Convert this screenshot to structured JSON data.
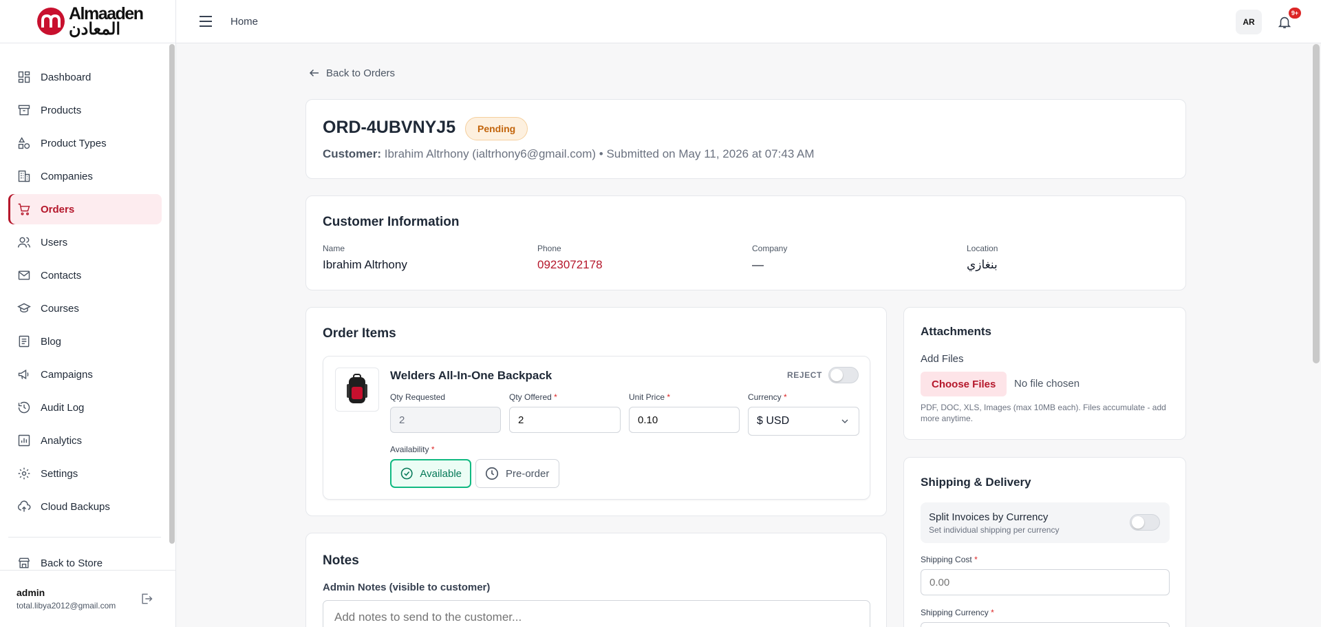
{
  "brand": {
    "name_en": "Almaaden",
    "name_ar": "المعادن"
  },
  "sidebar": {
    "items": [
      {
        "label": "Dashboard",
        "icon": "dashboard-icon"
      },
      {
        "label": "Products",
        "icon": "archive-box-icon"
      },
      {
        "label": "Product Types",
        "icon": "shapes-icon"
      },
      {
        "label": "Companies",
        "icon": "building-icon"
      },
      {
        "label": "Orders",
        "icon": "cart-icon",
        "active": true
      },
      {
        "label": "Users",
        "icon": "users-icon"
      },
      {
        "label": "Contacts",
        "icon": "mail-icon"
      },
      {
        "label": "Courses",
        "icon": "graduation-cap-icon"
      },
      {
        "label": "Blog",
        "icon": "document-icon"
      },
      {
        "label": "Campaigns",
        "icon": "megaphone-icon"
      },
      {
        "label": "Audit Log",
        "icon": "history-icon"
      },
      {
        "label": "Analytics",
        "icon": "chart-icon"
      },
      {
        "label": "Settings",
        "icon": "gear-icon"
      },
      {
        "label": "Cloud Backups",
        "icon": "cloud-backup-icon"
      }
    ],
    "back_to_store": "Back to Store",
    "user": {
      "name": "admin",
      "email": "total.libya2012@gmail.com"
    }
  },
  "topbar": {
    "breadcrumb": "Home",
    "lang": "AR",
    "notifications_badge": "9+"
  },
  "back_link": "Back to Orders",
  "order": {
    "id": "ORD-4UBVNYJ5",
    "status": "Pending",
    "customer_label": "Customer:",
    "customer_text": "Ibrahim Altrhony (ialtrhony6@gmail.com) • Submitted on May 11, 2026 at 07:43 AM"
  },
  "customer_info": {
    "title": "Customer Information",
    "name_label": "Name",
    "name": "Ibrahim Altrhony",
    "phone_label": "Phone",
    "phone": "0923072178",
    "company_label": "Company",
    "company": "—",
    "location_label": "Location",
    "location": "بنغازي"
  },
  "order_items": {
    "title": "Order Items",
    "item": {
      "name": "Welders All-In-One Backpack",
      "reject_label": "REJECT",
      "qty_requested_label": "Qty Requested",
      "qty_requested": "2",
      "qty_offered_label": "Qty Offered",
      "qty_offered": "2",
      "unit_price_label": "Unit Price",
      "unit_price": "0.10",
      "currency_label": "Currency",
      "currency": "$ USD",
      "availability_label": "Availability",
      "available_label": "Available",
      "preorder_label": "Pre-order",
      "selected_availability": "Available"
    }
  },
  "notes": {
    "title": "Notes",
    "admin_label": "Admin Notes (visible to customer)",
    "placeholder": "Add notes to send to the customer..."
  },
  "attachments": {
    "title": "Attachments",
    "add_files": "Add Files",
    "choose_button": "Choose Files",
    "no_file": "No file chosen",
    "hint": "PDF, DOC, XLS, Images (max 10MB each). Files accumulate - add more anytime."
  },
  "shipping": {
    "title": "Shipping & Delivery",
    "split_title": "Split Invoices by Currency",
    "split_sub": "Set individual shipping per currency",
    "split_enabled": false,
    "cost_label": "Shipping Cost",
    "cost_placeholder": "0.00",
    "currency_label": "Shipping Currency"
  },
  "colors": {
    "brand": "#b5172b",
    "pending_bg": "#fdf0df",
    "pending_text": "#c2640b",
    "available": "#047857"
  }
}
